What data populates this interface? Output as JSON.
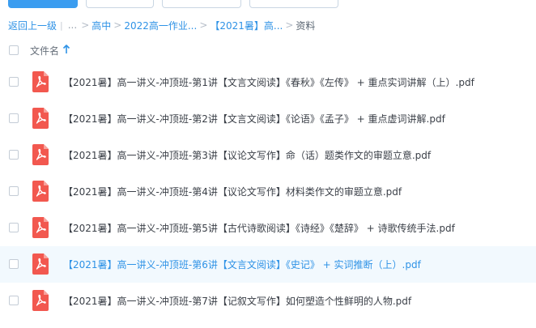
{
  "breadcrumb": {
    "back": "返回上一级",
    "ellipsis": "...",
    "items": [
      "高中",
      "2022高一作业...",
      "【2021暑】高..."
    ],
    "current": "资料"
  },
  "list_header": {
    "column_label": "文件名",
    "sort": "ascending"
  },
  "colors": {
    "accent": "#2e92e6",
    "pdf_red": "#f2584f",
    "hover_row": "#f2f9fe"
  },
  "files": [
    {
      "name": "【2021暑】高一讲义-冲顶班-第1讲【文言文阅读】《春秋》《左传》 + 重点实词讲解（上）.pdf",
      "icon": "pdf-icon",
      "hovered": false
    },
    {
      "name": "【2021暑】高一讲义-冲顶班-第2讲【文言文阅读】《论语》《孟子》 + 重点虚词讲解.pdf",
      "icon": "pdf-icon",
      "hovered": false
    },
    {
      "name": "【2021暑】高一讲义-冲顶班-第3讲【议论文写作】命（话）题类作文的审题立意.pdf",
      "icon": "pdf-icon",
      "hovered": false
    },
    {
      "name": "【2021暑】高一讲义-冲顶班-第4讲【议论文写作】材料类作文的审题立意.pdf",
      "icon": "pdf-icon",
      "hovered": false
    },
    {
      "name": "【2021暑】高一讲义-冲顶班-第5讲【古代诗歌阅读】《诗经》《楚辞》 + 诗歌传统手法.pdf",
      "icon": "pdf-icon",
      "hovered": false
    },
    {
      "name": "【2021暑】高一讲义-冲顶班-第6讲【文言文阅读】《史记》 + 实词推断（上）.pdf",
      "icon": "pdf-icon",
      "hovered": true
    },
    {
      "name": "【2021暑】高一讲义-冲顶班-第7讲【记叙文写作】如何塑造个性鲜明的人物.pdf",
      "icon": "pdf-icon",
      "hovered": false
    }
  ]
}
